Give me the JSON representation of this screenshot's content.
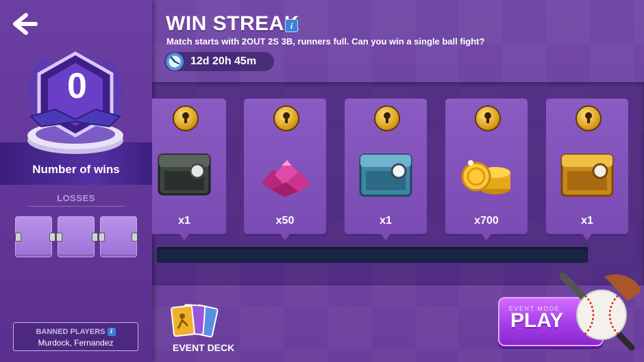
{
  "header": {
    "title": "WIN STREAK",
    "subtitle": "Match starts with 2OUT 2S 3B, runners full. Can you win a single ball fight?",
    "timer": "12d 20h 45m"
  },
  "sidebar": {
    "wins_count": "0",
    "wins_label": "Number of wins",
    "losses_title": "LOSSES",
    "loss_slots": 3,
    "banned_title": "BANNED PLAYERS",
    "banned_names": "Murdock, Fernandez"
  },
  "rewards": [
    {
      "name": "iron-chest",
      "qty": "x1"
    },
    {
      "name": "gems",
      "qty": "x50"
    },
    {
      "name": "blue-chest",
      "qty": "x1"
    },
    {
      "name": "coins",
      "qty": "x700"
    },
    {
      "name": "gold-chest",
      "qty": "x1"
    }
  ],
  "progress": {
    "fraction": 0
  },
  "footer": {
    "event_deck_label": "EVENT DECK",
    "play_mode": "EVENT MODE",
    "play_label": "PLAY"
  },
  "colors": {
    "background": "#6a3f9c",
    "sidebar": "#5b2f8f",
    "play_button": "#a53ee8",
    "progress_track": "#1a2445",
    "info_icon": "#3e7fd6"
  },
  "icons": [
    "back-arrow-icon",
    "trophy-badge-icon",
    "info-icon",
    "clock-icon",
    "lock-icon",
    "iron-chest-icon",
    "gem-icon",
    "blue-chest-icon",
    "coin-icon",
    "gold-chest-icon",
    "card-deck-icon",
    "baseball-bat-ball-icon"
  ]
}
